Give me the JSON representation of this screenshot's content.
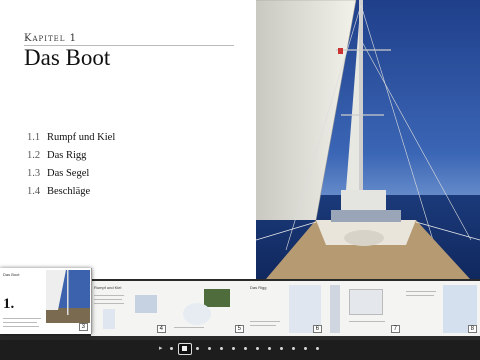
{
  "chapter": {
    "label": "Kapitel 1",
    "title": "Das Boot"
  },
  "toc": [
    {
      "num": "1.1",
      "text": "Rumpf und Kiel"
    },
    {
      "num": "1.2",
      "text": "Das Rigg"
    },
    {
      "num": "1.3",
      "text": "Das Segel"
    },
    {
      "num": "1.4",
      "text": "Beschläge"
    }
  ],
  "filmstrip": {
    "current_big_number": "1.",
    "current_title": "Das Boot",
    "thumbs": [
      {
        "page": "3",
        "heading": "Das Boot"
      },
      {
        "page": "4",
        "heading": "Rumpf und Kiel"
      },
      {
        "page": "5",
        "heading": ""
      },
      {
        "page": "6",
        "heading": "Das Rigg"
      },
      {
        "page": "7",
        "heading": ""
      },
      {
        "page": "8",
        "heading": ""
      }
    ]
  },
  "pager": {
    "icons": [
      "arrow-left-icon",
      "current-page-icon"
    ]
  }
}
